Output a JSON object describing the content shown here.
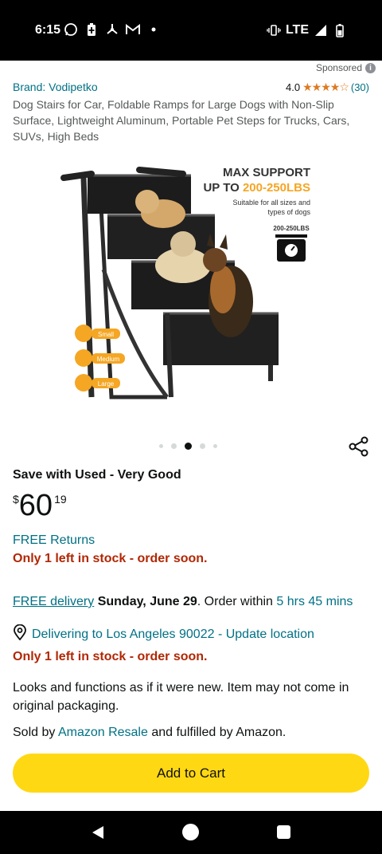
{
  "status_bar": {
    "time": "6:15",
    "network": "LTE",
    "icons": [
      "whatsapp-icon",
      "battery-saver-icon",
      "fan-icon",
      "gmail-icon",
      "notification-dot-icon",
      "vibrate-icon",
      "signal-icon",
      "battery-icon"
    ]
  },
  "sponsored": {
    "label": "Sponsored"
  },
  "product": {
    "brand": "Brand: Vodipetko",
    "rating": "4.0",
    "stars": "★★★★☆",
    "rating_count": "(30)",
    "title": "Dog Stairs for Car, Foldable Ramps for Large Dogs with Non-Slip Surface, Lightweight Aluminum, Portable Pet Steps for Trucks, Cars, SUVs, High Beds"
  },
  "image": {
    "headline_1": "MAX SUPPORT",
    "headline_2": "UP TO",
    "headline_2_highlight": "200-250LBS",
    "subtext_1": "Suitable for all sizes and",
    "subtext_2": "types of dogs",
    "scale_label": "200-250LBS",
    "size_small": "Small",
    "size_medium": "Medium",
    "size_large": "Large",
    "accent_color": "#f5a623",
    "carousel_total": 5,
    "carousel_active": 3
  },
  "offer": {
    "title": "Save with Used - Very Good",
    "currency": "$",
    "price_whole": "60",
    "price_fraction": "19",
    "free_returns": "FREE Returns",
    "stock_1": "Only 1 left in stock - order soon.",
    "delivery_link": "FREE delivery",
    "delivery_date": "Sunday, June 29",
    "delivery_mid": ". Order within ",
    "delivery_time": "5 hrs 45 mins",
    "location": "Delivering to Los Angeles 90022 - Update location",
    "stock_2": "Only 1 left in stock - order soon.",
    "condition": "Looks and functions as if it were new. Item may not come in original packaging.",
    "sold_by_prefix": "Sold by ",
    "sold_by_seller": "Amazon Resale",
    "sold_by_suffix": " and fulfilled by Amazon.",
    "add_to_cart": "Add to Cart"
  },
  "colors": {
    "link": "#007185",
    "alert": "#b12704",
    "button": "#ffd814",
    "star": "#de7921"
  }
}
